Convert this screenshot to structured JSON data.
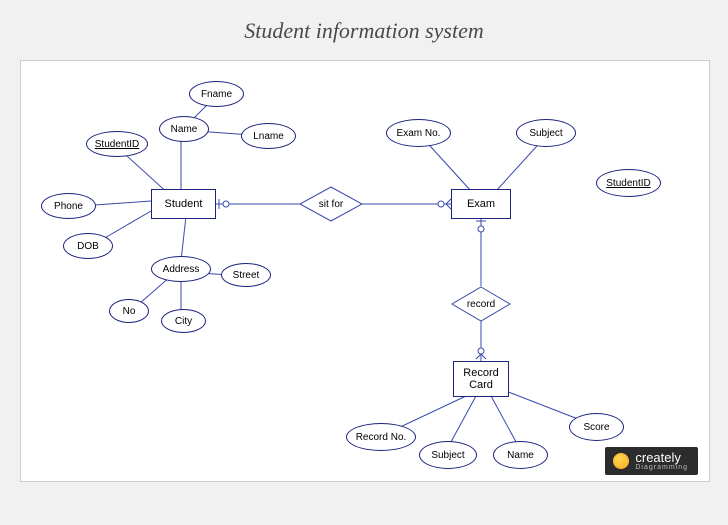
{
  "title": "Student information system",
  "entities": {
    "student": "Student",
    "exam": "Exam",
    "record_card": "Record\nCard"
  },
  "relationships": {
    "sit_for": "sit for",
    "record": "record"
  },
  "attributes": {
    "student": {
      "student_id": "StudentID",
      "fname": "Fname",
      "name": "Name",
      "lname": "Lname",
      "phone": "Phone",
      "dob": "DOB",
      "address": "Address",
      "no": "No",
      "city": "City",
      "street": "Street"
    },
    "exam": {
      "exam_no": "Exam No.",
      "subject": "Subject",
      "student_id2": "StudentID"
    },
    "record_card": {
      "record_no": "Record No.",
      "subject": "Subject",
      "name": "Name",
      "score": "Score"
    }
  },
  "watermark": {
    "brand": "creately",
    "tagline": "Diagramming"
  },
  "diagram_meta": {
    "type": "ER diagram",
    "key_attributes": [
      "StudentID"
    ],
    "composite_attributes": {
      "Address": [
        "No",
        "City",
        "Street"
      ]
    },
    "entity_relationships": [
      {
        "from": "Student",
        "rel": "sit for",
        "to": "Exam"
      },
      {
        "from": "Exam",
        "rel": "record",
        "to": "Record Card"
      }
    ]
  }
}
